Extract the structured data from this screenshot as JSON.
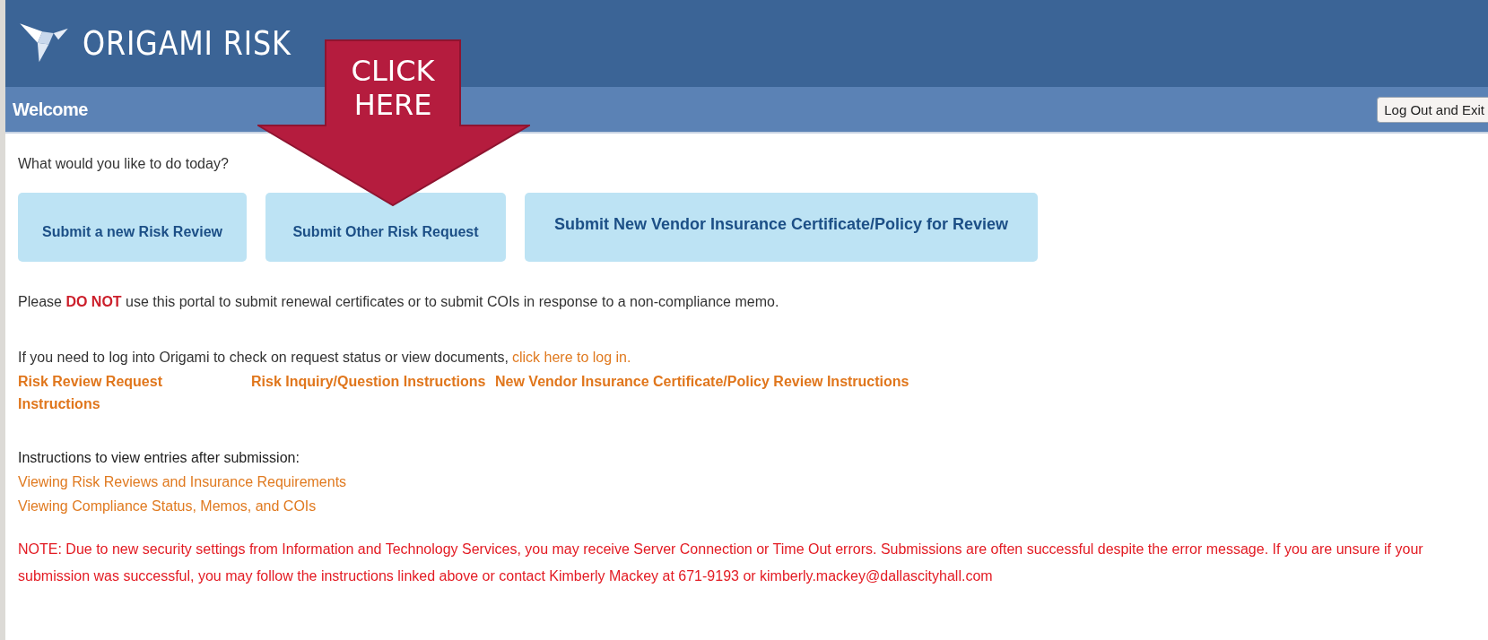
{
  "header": {
    "logo_text": "ORIGAMI RISK"
  },
  "welcome_bar": {
    "title": "Welcome",
    "logout_button": "Log Out and Exit"
  },
  "callout": {
    "text_lines": [
      "CLICK",
      "HERE"
    ]
  },
  "prompt": "What would you like to do today?",
  "action_buttons": [
    {
      "label": "Submit a new Risk Review",
      "kind": "standard"
    },
    {
      "label": "Submit Other Risk Request",
      "kind": "standard"
    },
    {
      "label": "Submit New Vendor Insurance Certificate/Policy for Review",
      "kind": "wide"
    }
  ],
  "warning": "Please **DO NOT** use this portal to submit renewal certificates or to submit COIs in response to a non-compliance memo.",
  "login_note": {
    "text": "If you need to log into Origami to check on request status or view documents,",
    "link": "click here to log in."
  },
  "instruction_links": [
    "Risk Review Request Instructions",
    "Risk Inquiry/Question Instructions",
    "New Vendor Insurance Certificate/Policy Review Instructions"
  ],
  "view_instructions": {
    "heading": "Instructions to view entries after submission:",
    "links": [
      "Viewing Risk Reviews and Insurance Requirements",
      "Viewing Compliance Status, Memos, and COIs"
    ]
  },
  "notice": "NOTE: Due to new security settings from Information and Technology Services, you may receive Server Connection or Time Out errors. Submissions are often successful despite the error message. If you are unsure if your submission was successful, you may follow the instructions linked above or contact Kimberly Mackey at 671-9193 or kimberly.mackey@dallascityhall.com"
}
